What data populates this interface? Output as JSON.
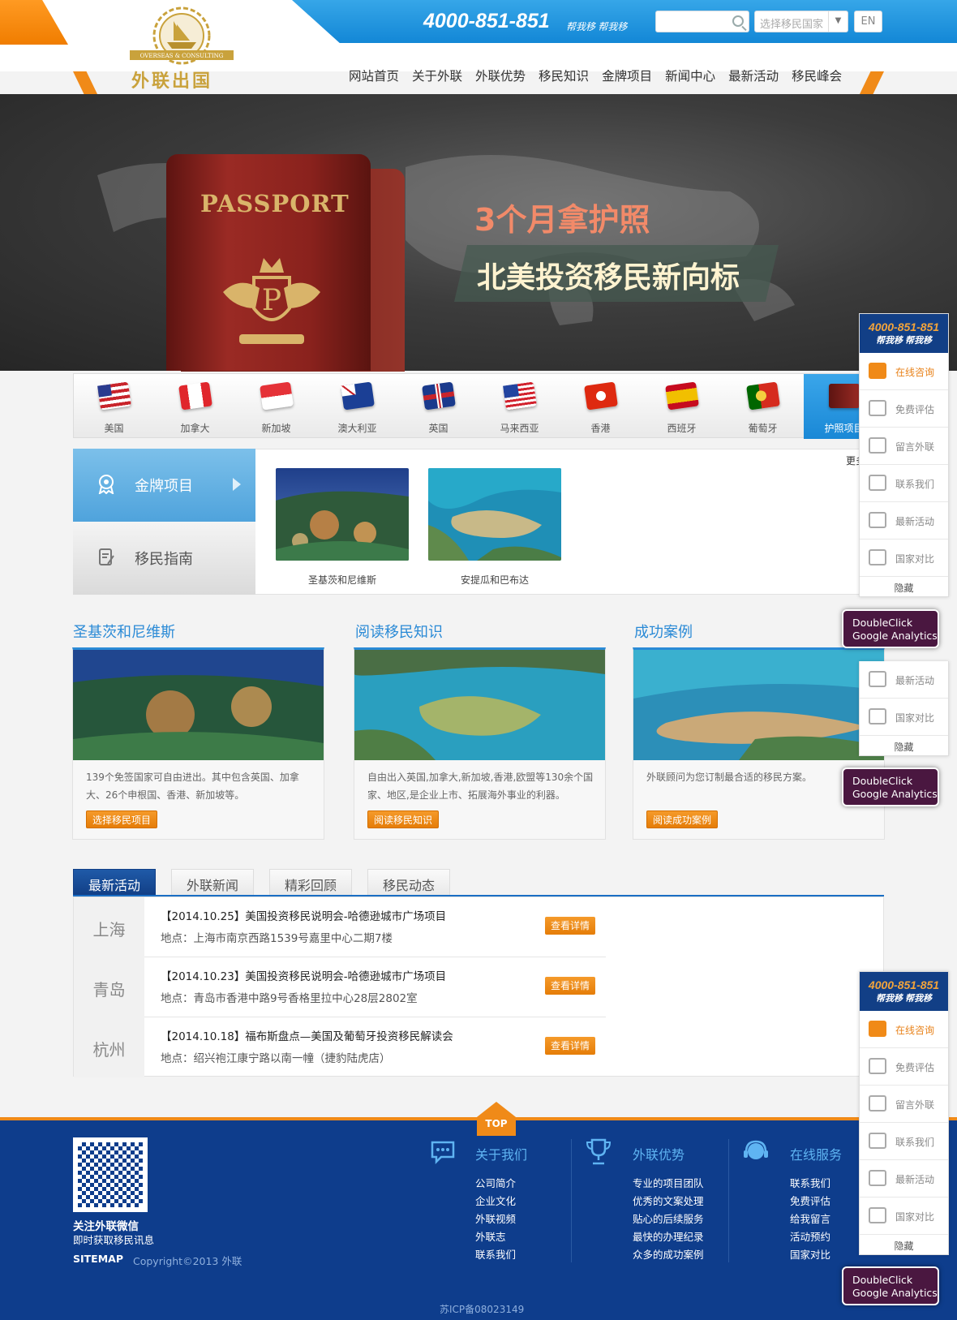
{
  "header": {
    "phone": "4000-851-851",
    "slogan": "帮我移 帮我移",
    "search_placeholder": "",
    "country_select": "选择移民国家",
    "lang": "EN",
    "logo_text": "外联出国",
    "logo_sub": "OVERSEAS & CONSULTING"
  },
  "nav": [
    "网站首页",
    "关于外联",
    "外联优势",
    "移民知识",
    "金牌项目",
    "新闻中心",
    "最新活动",
    "移民峰会"
  ],
  "banner": {
    "passport_title": "PASSPORT",
    "line1": "3个月拿护照",
    "line2": "北美投资移民新向标"
  },
  "flags": [
    {
      "name": "美国",
      "color": "#c8242b"
    },
    {
      "name": "加拿大",
      "color": "#e0262c"
    },
    {
      "name": "新加坡",
      "color": "#e53238"
    },
    {
      "name": "澳大利亚",
      "color": "#1b3f95"
    },
    {
      "name": "英国",
      "color": "#1a3a8c"
    },
    {
      "name": "马来西亚",
      "color": "#2244a0"
    },
    {
      "name": "香港",
      "color": "#de2910"
    },
    {
      "name": "西班牙",
      "color": "#f1bf00"
    },
    {
      "name": "葡萄牙",
      "color": "#d52b1e"
    },
    {
      "name": "护照项目",
      "color": "#7d1d17"
    }
  ],
  "gold": {
    "tab_active": "金牌项目",
    "tab_other": "移民指南",
    "more": "更多",
    "items": [
      {
        "caption": "圣基茨和尼维斯"
      },
      {
        "caption": "安提瓜和巴布达"
      }
    ]
  },
  "cards": [
    {
      "title": "圣基茨和尼维斯",
      "desc": "139个免签国家可自由进出。其中包含英国、加拿大、26个申根国、香港、新加坡等。",
      "button": "选择移民项目"
    },
    {
      "title": "阅读移民知识",
      "desc": "自由出入英国,加拿大,新加坡,香港,欧盟等130余个国家、地区,是企业上市、拓展海外事业的利器。",
      "button": "阅读移民知识"
    },
    {
      "title": "成功案例",
      "desc": "外联顾问为您订制最合适的移民方案。",
      "button": "阅读成功案例"
    }
  ],
  "news_tabs": [
    "最新活动",
    "外联新闻",
    "精彩回顾",
    "移民动态"
  ],
  "events": [
    {
      "city": "上海",
      "title": "【2014.10.25】美国投资移民说明会-哈德逊城市广场项目",
      "addr": "地点：上海市南京西路1539号嘉里中心二期7楼",
      "btn": "查看详情"
    },
    {
      "city": "青岛",
      "title": "【2014.10.23】美国投资移民说明会-哈德逊城市广场项目",
      "addr": "地点：青岛市香港中路9号香格里拉中心28层2802室",
      "btn": "查看详情"
    },
    {
      "city": "杭州",
      "title": "【2014.10.18】福布斯盘点—美国及葡萄牙投资移民解读会",
      "addr": "地点：绍兴袍江康宁路以南一幢（捷豹陆虎店）",
      "btn": "查看详情"
    }
  ],
  "footer": {
    "top": "TOP",
    "qr_line1": "关注外联微信",
    "qr_line2": "即时获取移民讯息",
    "sitemap": "SITEMAP",
    "copyright": "Copyright©2013 外联",
    "icp": "苏ICP备08023149",
    "cols": [
      {
        "title": "关于我们",
        "links": [
          "公司简介",
          "企业文化",
          "外联视频",
          "外联志",
          "联系我们"
        ]
      },
      {
        "title": "外联优势",
        "links": [
          "专业的项目团队",
          "优秀的文案处理",
          "贴心的后续服务",
          "最快的办理纪录",
          "众多的成功案例"
        ]
      },
      {
        "title": "在线服务",
        "links": [
          "联系我们",
          "免费评估",
          "给我留言",
          "活动预约",
          "国家对比"
        ]
      }
    ]
  },
  "side": {
    "phone": "4000-851-851",
    "slogan": "帮我移 帮我移",
    "items": [
      "在线咨询",
      "免费评估",
      "留言外联",
      "联系我们",
      "最新活动",
      "国家对比"
    ],
    "hide": "隐藏",
    "dc_line1": "DoubleClick",
    "dc_line2": "Google Analytics"
  }
}
